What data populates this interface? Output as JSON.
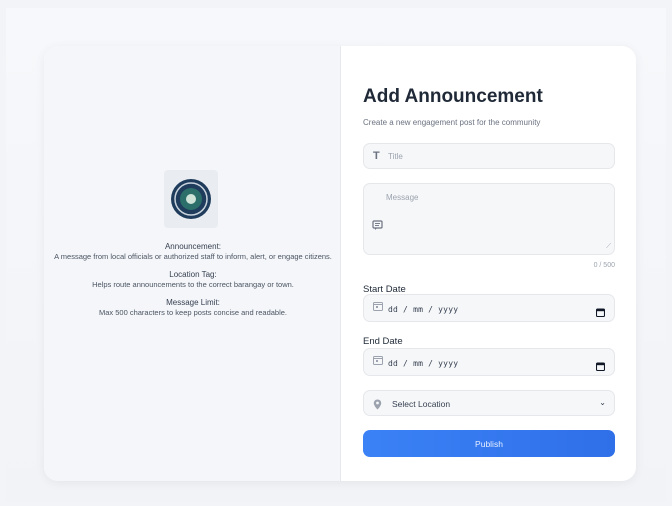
{
  "form": {
    "title": "Add Announcement",
    "subtitle": "Create a new engagement post for the community",
    "title_placeholder": "Title",
    "message_placeholder": "Message",
    "char_counter": "0 / 500",
    "start_date_label": "Start Date",
    "start_date_value": "dd / mm / yyyy",
    "end_date_label": "End Date",
    "end_date_value": "dd / mm / yyyy",
    "location_selected": "Select Location",
    "publish_label": "Publish"
  },
  "info": [
    {
      "heading": "Announcement:",
      "text": "A message from local officials or authorized staff to inform, alert, or engage citizens."
    },
    {
      "heading": "Location Tag:",
      "text": "Helps route announcements to the correct barangay or town."
    },
    {
      "heading": "Message Limit:",
      "text": "Max 500 characters to keep posts concise and readable."
    }
  ],
  "colors": {
    "accent": "#3b82f6",
    "panel_bg": "#f4f6f9",
    "field_bg": "#f6f7f9"
  },
  "icons": {
    "title": "text-t-icon",
    "message": "message-icon",
    "date": "calendar-icon",
    "location": "map-pin-icon",
    "select": "chevron-down-icon"
  }
}
